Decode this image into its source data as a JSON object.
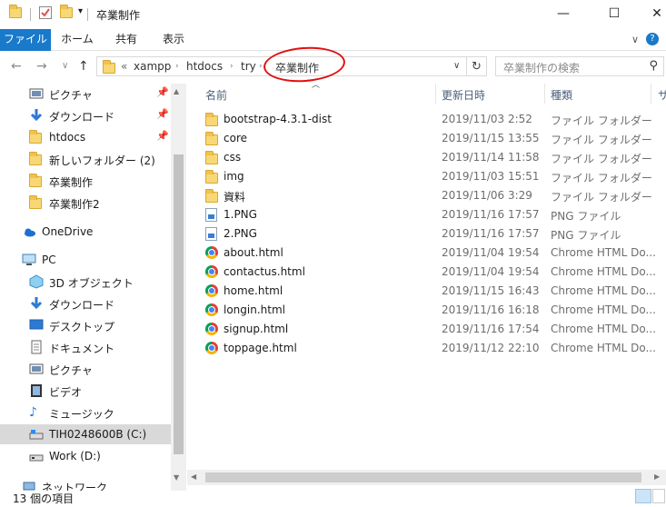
{
  "window": {
    "title": "卒業制作",
    "minimize": "—",
    "maximize": "☐",
    "close": "✕"
  },
  "ribbon": {
    "tabs": [
      "ファイル",
      "ホーム",
      "共有",
      "表示"
    ],
    "expand_icon": "chevron-down-icon",
    "help_icon": "help-icon"
  },
  "address": {
    "prefix": "«",
    "crumbs": [
      "xampp",
      "htdocs",
      "try",
      "卒業制作"
    ],
    "refresh_icon": "refresh-icon"
  },
  "search": {
    "placeholder": "卒業制作の検索"
  },
  "nav": {
    "quick_access": [
      {
        "label": "ピクチャ",
        "icon": "pictures-icon",
        "pinned": true
      },
      {
        "label": "ダウンロード",
        "icon": "download-icon",
        "pinned": true
      },
      {
        "label": "htdocs",
        "icon": "folder-icon",
        "pinned": true
      },
      {
        "label": "新しいフォルダー (2)",
        "icon": "folder-icon",
        "pinned": false
      },
      {
        "label": "卒業制作",
        "icon": "folder-icon",
        "pinned": false
      },
      {
        "label": "卒業制作2",
        "icon": "folder-icon",
        "pinned": false
      }
    ],
    "onedrive": "OneDrive",
    "pc": "PC",
    "pc_items": [
      {
        "label": "3D オブジェクト",
        "icon": "3d-objects-icon"
      },
      {
        "label": "ダウンロード",
        "icon": "download-icon"
      },
      {
        "label": "デスクトップ",
        "icon": "desktop-icon"
      },
      {
        "label": "ドキュメント",
        "icon": "documents-icon"
      },
      {
        "label": "ピクチャ",
        "icon": "pictures-icon"
      },
      {
        "label": "ビデオ",
        "icon": "video-icon"
      },
      {
        "label": "ミュージック",
        "icon": "music-icon"
      },
      {
        "label": "TIH0248600B (C:)",
        "icon": "drive-icon"
      },
      {
        "label": "Work (D:)",
        "icon": "drive-icon"
      }
    ],
    "network": "ネットワーク"
  },
  "columns": {
    "name": "名前",
    "date": "更新日時",
    "type": "種類",
    "size": "サ"
  },
  "files": [
    {
      "name": "bootstrap-4.3.1-dist",
      "date": "2019/11/03 2:52",
      "type": "ファイル フォルダー",
      "icon": "folder-icon"
    },
    {
      "name": "core",
      "date": "2019/11/15 13:55",
      "type": "ファイル フォルダー",
      "icon": "folder-icon"
    },
    {
      "name": "css",
      "date": "2019/11/14 11:58",
      "type": "ファイル フォルダー",
      "icon": "folder-icon"
    },
    {
      "name": "img",
      "date": "2019/11/03 15:51",
      "type": "ファイル フォルダー",
      "icon": "folder-icon"
    },
    {
      "name": "資料",
      "date": "2019/11/06 3:29",
      "type": "ファイル フォルダー",
      "icon": "folder-icon"
    },
    {
      "name": "1.PNG",
      "date": "2019/11/16 17:57",
      "type": "PNG ファイル",
      "icon": "png-file-icon"
    },
    {
      "name": "2.PNG",
      "date": "2019/11/16 17:57",
      "type": "PNG ファイル",
      "icon": "png-file-icon"
    },
    {
      "name": "about.html",
      "date": "2019/11/04 19:54",
      "type": "Chrome HTML Do...",
      "icon": "chrome-icon"
    },
    {
      "name": "contactus.html",
      "date": "2019/11/04 19:54",
      "type": "Chrome HTML Do...",
      "icon": "chrome-icon"
    },
    {
      "name": "home.html",
      "date": "2019/11/15 16:43",
      "type": "Chrome HTML Do...",
      "icon": "chrome-icon"
    },
    {
      "name": "longin.html",
      "date": "2019/11/16 16:18",
      "type": "Chrome HTML Do...",
      "icon": "chrome-icon"
    },
    {
      "name": "signup.html",
      "date": "2019/11/16 17:54",
      "type": "Chrome HTML Do...",
      "icon": "chrome-icon"
    },
    {
      "name": "toppage.html",
      "date": "2019/11/12 22:10",
      "type": "Chrome HTML Do...",
      "icon": "chrome-icon"
    }
  ],
  "status": {
    "item_count": "13 個の項目"
  },
  "colors": {
    "file_tab": "#1979ca",
    "folder": "#f8d775",
    "annotation": "#e01010"
  }
}
